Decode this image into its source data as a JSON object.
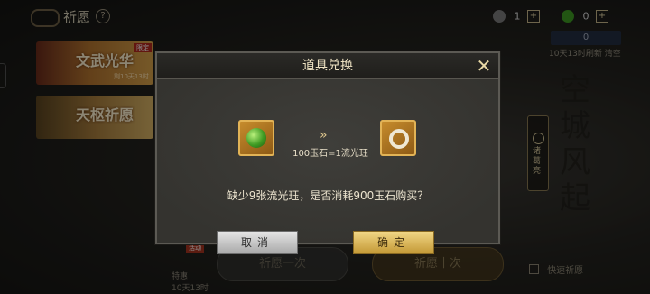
{
  "header": {
    "title": "祈愿",
    "help": "?",
    "currencies": [
      {
        "icon": "coin-icon",
        "value": "1",
        "color": "#8b8b8b"
      },
      {
        "icon": "jade-icon",
        "value": "0",
        "color": "#3f9b23"
      }
    ],
    "ticket_value": "0",
    "refresh_timer": "10天13时刷新 清空"
  },
  "banners": [
    {
      "title": "文武光华",
      "sub": "剩10天13时",
      "tag": "限定"
    },
    {
      "title": "天枢祈愿",
      "sub": "",
      "tag": ""
    }
  ],
  "side": {
    "calligraphy": "空城风起",
    "tab_label": "诸葛亮"
  },
  "bottom": {
    "tag": "活动",
    "timer_line1": "特惠",
    "timer_line2": "10天13时",
    "wish_one": "祈愿一次",
    "wish_ten": "祈愿十次",
    "quick": "快速祈愿"
  },
  "dialog": {
    "title": "道具兑换",
    "rate": "100玉石=1流光珏",
    "message": "缺少9张流光珏，是否消耗900玉石购买？",
    "cancel": "取消",
    "confirm": "确定",
    "from_item": "jade-stone-icon",
    "to_item": "liuguang-jue-icon",
    "arrow": "»"
  }
}
